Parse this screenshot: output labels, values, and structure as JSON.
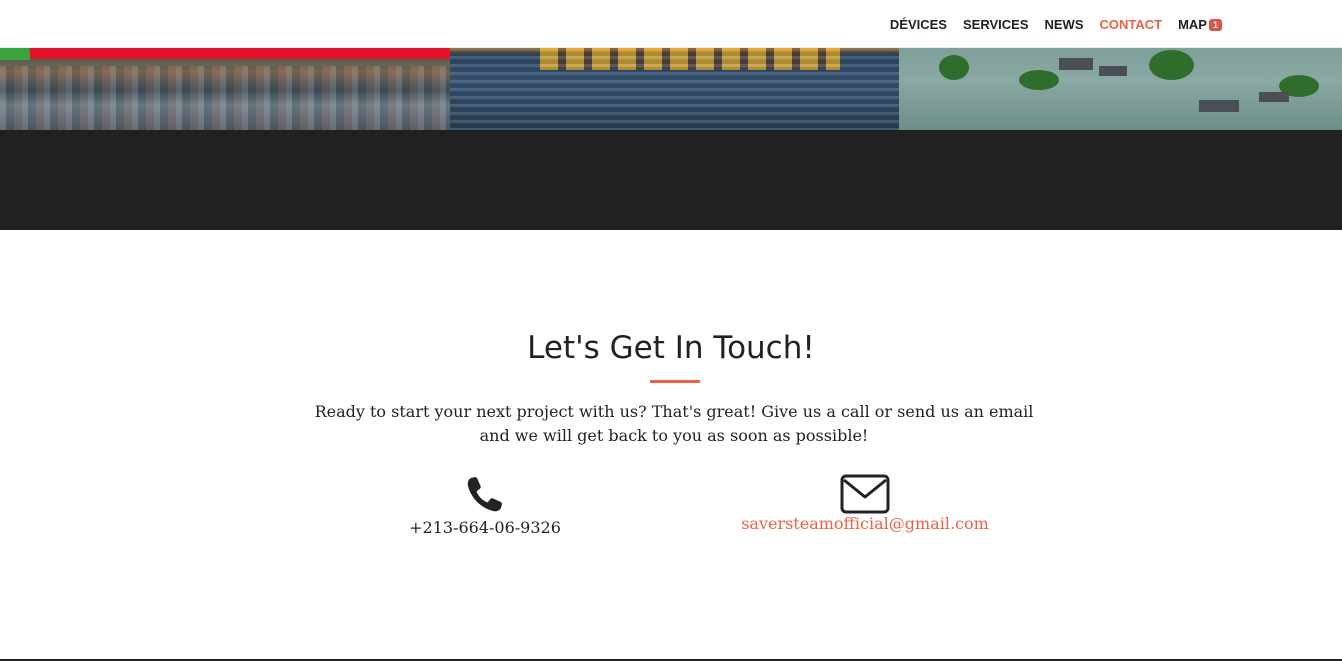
{
  "nav": {
    "items": [
      {
        "label": "DÉVICES",
        "active": false
      },
      {
        "label": "SERVICES",
        "active": false
      },
      {
        "label": "NEWS",
        "active": false
      },
      {
        "label": "CONTACT",
        "active": true
      },
      {
        "label": "MAP",
        "active": false
      }
    ],
    "map_badge": "1"
  },
  "contact": {
    "heading": "Let's Get In Touch!",
    "lead": "Ready to start your next project with us? That's great! Give us a call or send us an email and we will get back to you as soon as possible!",
    "phone": "+213-664-06-9326",
    "email": "saversteamofficial@gmail.com"
  },
  "colors": {
    "accent": "#f05f40",
    "dark_band": "#212121",
    "text": "#222222",
    "badge": "#d9534f"
  },
  "icons": {
    "phone": "phone-icon",
    "email": "envelope-icon"
  }
}
